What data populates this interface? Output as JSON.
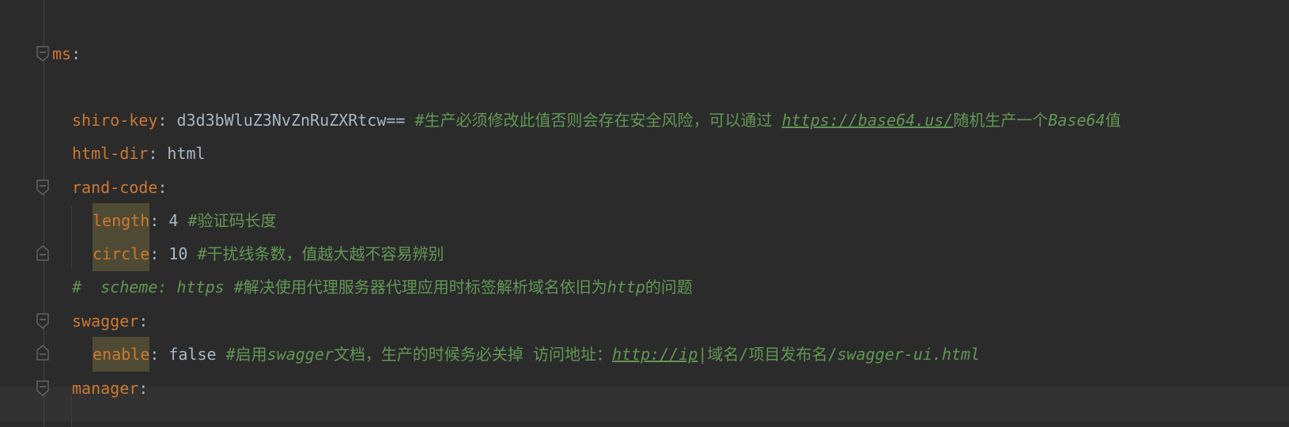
{
  "lines": {
    "l1": {
      "key": "ms",
      "colon": ":"
    },
    "l2": {
      "key": "shiro-key",
      "colon": ": ",
      "value": "d3d3bWluZ3NvZnRuZXRtcw== ",
      "comment_a": "#生产必须修改此值否则会存在安全风险，可以通过 ",
      "comment_link": "https://base64.us/",
      "comment_b": "随机生产一个",
      "comment_c": "Base64",
      "comment_d": "值"
    },
    "l3": {
      "key": "html-dir",
      "colon": ": ",
      "value": "html"
    },
    "l4": {
      "key": "rand-code",
      "colon": ":"
    },
    "l5": {
      "key": "length",
      "colon": ": ",
      "value": "4 ",
      "comment": "#验证码长度"
    },
    "l6": {
      "key": "circle",
      "colon": ": ",
      "value": "10 ",
      "comment": "#干扰线条数，值越大越不容易辨别"
    },
    "l7": {
      "comment_a": "#  scheme: https ",
      "comment_b": "#解决使用代理服务器代理应用时标签解析域名依旧为",
      "comment_c": "http",
      "comment_d": "的问题"
    },
    "l8": {
      "key": "swagger",
      "colon": ":"
    },
    "l9": {
      "key": "enable",
      "colon": ": ",
      "value": "false ",
      "comment_a": "#启用",
      "comment_b": "swagger",
      "comment_c": "文档，生产的时候务必关掉 访问地址：",
      "comment_link": "http://ip",
      "comment_sep": "|",
      "comment_d": "域名/项目发布名/",
      "comment_e": "swagger-ui.html"
    },
    "l10": {
      "key": "manager",
      "colon": ":"
    }
  },
  "colors": {
    "background": "#2b2b2b",
    "key": "#cc7832",
    "value": "#a9b7c6",
    "comment": "#629755",
    "highlight": "#4f4a33",
    "current_line": "#323232"
  },
  "icons": {
    "fold_open": "fold-open-icon",
    "fold_end": "fold-end-icon"
  }
}
